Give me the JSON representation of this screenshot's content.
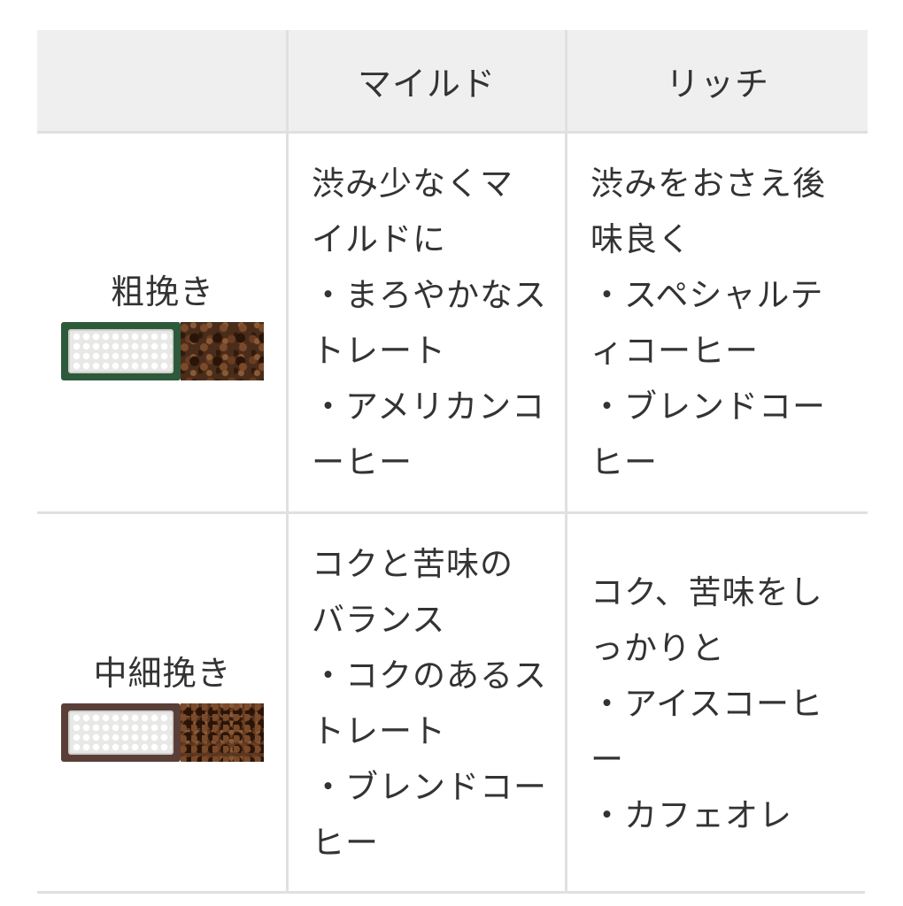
{
  "table": {
    "headers": [
      "",
      "マイルド",
      "リッチ"
    ],
    "rows": [
      {
        "label": "粗挽き",
        "grind_icon": "coarse-grinder-icon",
        "mild": [
          "渋み少なくマ",
          "イルドに",
          "・まろやかなス",
          "トレート",
          "・アメリカンコ",
          "ーヒー"
        ],
        "rich": [
          "渋みをおさえ後",
          "味良く",
          "・スペシャルテ",
          "ィコーヒー",
          "・ブレンドコー",
          "ヒー"
        ]
      },
      {
        "label": "中細挽き",
        "grind_icon": "medium-fine-grinder-icon",
        "mild": [
          "コクと苦味の",
          "バランス",
          "・コクのあるス",
          "トレート",
          "・ブレンドコー",
          "ヒー"
        ],
        "rich": [
          "コク、苦味をし",
          "っかりと",
          "・アイスコーヒ",
          "ー",
          "・カフェオレ"
        ]
      }
    ]
  },
  "colors": {
    "header_bg": "#efefef",
    "border": "#e0e0e0",
    "coarse_blade": "#2d5a3a",
    "medium_blade": "#5a3f38"
  }
}
